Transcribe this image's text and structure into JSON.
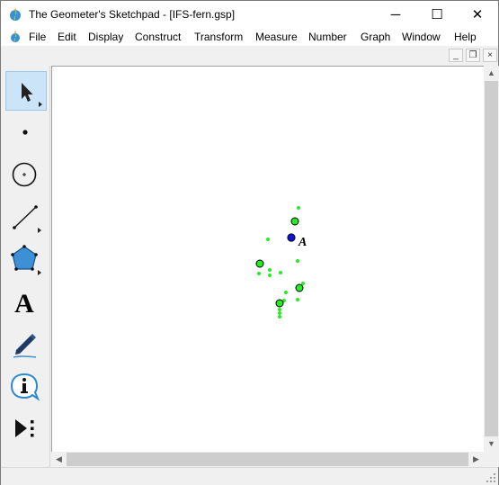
{
  "window": {
    "title": "The Geometer's Sketchpad - [IFS-fern.gsp]",
    "controls": {
      "minimize": "─",
      "maximize": "☐",
      "close": "✕"
    }
  },
  "menu": {
    "items": [
      "File",
      "Edit",
      "Display",
      "Construct",
      "Transform",
      "Measure",
      "Number",
      "Graph",
      "Window",
      "Help"
    ]
  },
  "mdi_controls": {
    "minimize": "_",
    "restore": "❐",
    "close": "×"
  },
  "toolbox": {
    "tools": [
      {
        "name": "arrow-tool",
        "icon": "arrow-selection-icon",
        "selected": true
      },
      {
        "name": "point-tool",
        "icon": "point-icon",
        "selected": false
      },
      {
        "name": "compass-tool",
        "icon": "compass-circle-icon",
        "selected": false
      },
      {
        "name": "straightedge-tool",
        "icon": "segment-icon",
        "selected": false
      },
      {
        "name": "polygon-tool",
        "icon": "polygon-icon",
        "selected": false
      },
      {
        "name": "text-tool",
        "icon": "text-A-icon",
        "selected": false
      },
      {
        "name": "marker-tool",
        "icon": "marker-pen-icon",
        "selected": false
      },
      {
        "name": "information-tool",
        "icon": "info-icon",
        "selected": false
      },
      {
        "name": "custom-tool",
        "icon": "custom-tools-icon",
        "selected": false
      }
    ],
    "text_tool_glyph": "A"
  },
  "sketch": {
    "point_label": "A",
    "colors": {
      "fern_points": "#22ee22",
      "point_A": "#1010d0",
      "outline": "#000000"
    }
  },
  "scrollbars": {
    "up": "▲",
    "down": "▼",
    "left": "◀",
    "right": "▶"
  }
}
